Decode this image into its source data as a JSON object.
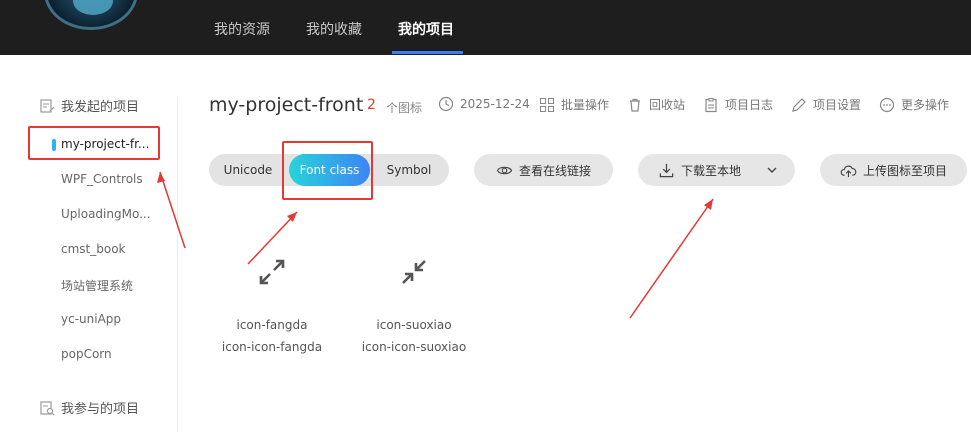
{
  "header": {
    "nav": [
      {
        "label": "我的资源"
      },
      {
        "label": "我的收藏"
      },
      {
        "label": "我的项目"
      }
    ]
  },
  "sidebar": {
    "my_projects_heading": "我发起的项目",
    "items": [
      {
        "label": "my-project-fr..."
      },
      {
        "label": "WPF_Controls"
      },
      {
        "label": "UploadingMo..."
      },
      {
        "label": "cmst_book"
      },
      {
        "label": "场站管理系统"
      },
      {
        "label": "yc-uniApp"
      },
      {
        "label": "popCorn"
      }
    ],
    "joined_heading": "我参与的项目"
  },
  "project": {
    "title": "my-project-front",
    "icon_count": "2",
    "icon_count_unit": "个图标",
    "date": "2025-12-24",
    "actions": [
      "批量操作",
      "回收站",
      "项目日志",
      "项目设置",
      "更多操作"
    ]
  },
  "toolbar": {
    "tabs": [
      "Unicode",
      "Font class",
      "Symbol"
    ],
    "view_link": "查看在线链接",
    "download": "下载至本地",
    "upload": "上传图标至项目"
  },
  "icons": [
    {
      "name": "icon-fangda",
      "class_name": "icon-icon-fangda",
      "glyph": "expand-arrows-icon"
    },
    {
      "name": "icon-suoxiao",
      "class_name": "icon-icon-suoxiao",
      "glyph": "collapse-arrows-icon"
    }
  ],
  "colors": {
    "accent_gradient_start": "#27d3d9",
    "accent_gradient_end": "#3c85f5",
    "annotation_red": "#e53935",
    "topbar": "#1e1e1e"
  }
}
